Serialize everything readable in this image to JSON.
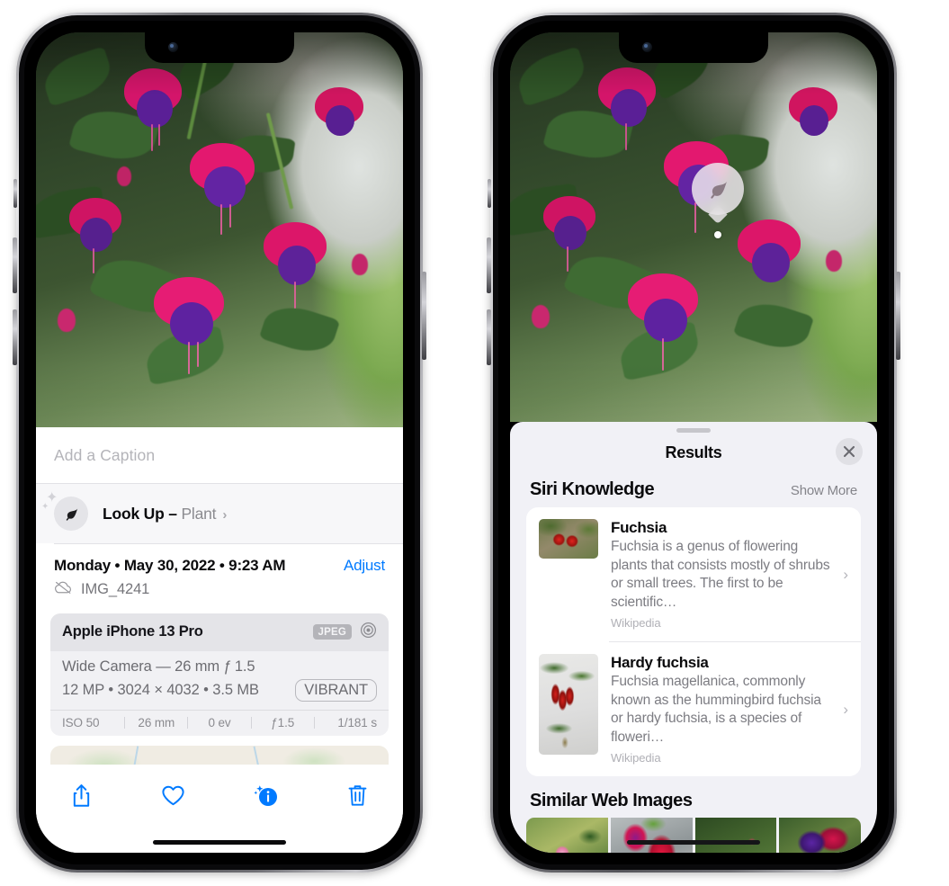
{
  "left_phone": {
    "caption_placeholder": "Add a Caption",
    "lookup": {
      "label": "Look Up – ",
      "subject": "Plant",
      "chevron": "›",
      "icon": "leaf-icon"
    },
    "date": "Monday • May 30, 2022 • 9:23 AM",
    "adjust_label": "Adjust",
    "filename": "IMG_4241",
    "cloud_icon": "icloud-slash-icon",
    "metadata": {
      "device": "Apple iPhone 13 Pro",
      "format_badge": "JPEG",
      "lens_icon": "aperture-icon",
      "lens_line": "Wide Camera — 26 mm ƒ 1.5",
      "size_line": "12 MP • 3024 × 4032 • 3.5 MB",
      "vibrant_badge": "VIBRANT",
      "exif": [
        "ISO 50",
        "26 mm",
        "0 ev",
        "ƒ1.5",
        "1/181 s"
      ]
    },
    "toolbar": [
      {
        "name": "share-button",
        "icon": "share-icon"
      },
      {
        "name": "favorite-button",
        "icon": "heart-icon"
      },
      {
        "name": "info-button",
        "icon": "info-sparkle-icon"
      },
      {
        "name": "delete-button",
        "icon": "trash-icon"
      }
    ]
  },
  "right_phone": {
    "lookup_pin_icon": "leaf-icon",
    "sheet_title": "Results",
    "close_icon": "close-icon",
    "siri_section": {
      "title": "Siri Knowledge",
      "action": "Show More",
      "results": [
        {
          "title": "Fuchsia",
          "description": "Fuchsia is a genus of flowering plants that consists mostly of shrubs or small trees. The first to be scientific…",
          "source": "Wikipedia",
          "chevron": "›"
        },
        {
          "title": "Hardy fuchsia",
          "description": "Fuchsia magellanica, commonly known as the hummingbird fuchsia or hardy fuchsia, is a species of floweri…",
          "source": "Wikipedia",
          "chevron": "›"
        }
      ]
    },
    "web_section": {
      "title": "Similar Web Images",
      "thumbnails": [
        "web-image-1",
        "web-image-2",
        "web-image-3",
        "web-image-4"
      ]
    }
  },
  "colors": {
    "accent": "#007AFF",
    "sheet_bg": "#F1F1F6",
    "card_bg": "#FFFFFF",
    "muted_text": "#7C7C82"
  }
}
